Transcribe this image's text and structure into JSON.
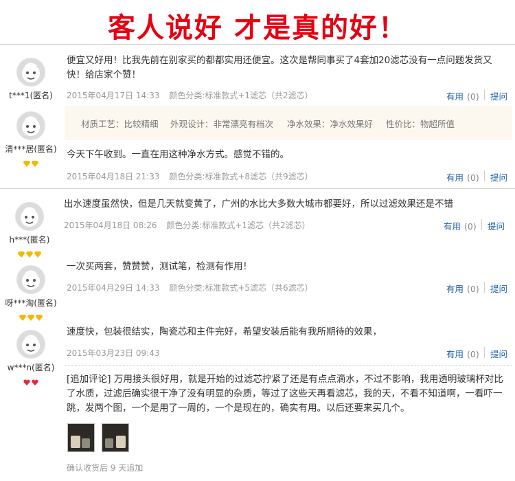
{
  "banner": {
    "title": "客人说好 才是真的好！",
    "color": "#e60012"
  },
  "actions": {
    "useful": "有用",
    "ask": "提问"
  },
  "tags": [
    "材质工艺：比较精细",
    "外观设计：非常漂亮有档次",
    "净水效果：净水效果好",
    "性价比：物超所值"
  ],
  "reviews": [
    {
      "user": "t***1(匿名)",
      "text": "便宜又好用！比我先前在别家买的都都实用还便宜。这次是帮同事买了4套加20滤芯没有一点问题发货又快！给店家个赞！",
      "date": "2015年04月17日 14:33",
      "sku": "颜色分类:标准款式+1滤芯（共2滤芯）",
      "useful_count": "(0)"
    },
    {
      "user": "清***居(匿名)",
      "text": "今天下午收到。一直在用这种净水方式。感觉不错的。",
      "date": "2015年04月18日 21:33",
      "sku": "颜色分类:标准款式+8滤芯（共9滤芯）",
      "useful_count": "(0)"
    },
    {
      "user": "h***(匿名)",
      "text": "出水速度虽然快，但是几天就变黄了，广州的水比大多数大城市都要好，所以过滤效果还是不错",
      "date": "2015年04月18日 08:26",
      "sku": "颜色分类:标准款式+1滤芯（共2滤芯）",
      "useful_count": "(0)"
    },
    {
      "user": "呀***淘(匿名)",
      "text": "一次买两套，赞赞赞，测试笔，检测有作用！",
      "date": "2015年04月29日 14:33",
      "sku": "颜色分类:标准款式+5滤芯（共6滤芯）",
      "useful_count": "(0)"
    },
    {
      "user": "w***n(匿名)",
      "text": "速度快，包装很结实，陶瓷芯和主件完好，希望安装后能有我所期待的效果，",
      "date": "2015年03月23日 09:43",
      "sku": "",
      "useful_count": "(0)",
      "followup": {
        "text": "[追加评论] 万用接头很好用，就是开始的过滤芯拧紧了还是有点点滴水，不过不影响，我用透明玻璃杯对比了水质，过滤后确实很干净了没有明显的杂质，等过了这些天再看滤芯，我的天，不看不知道啊，一看吓一跳，发两个图，一个是用了一周的，一个是现在的，确实有用。以后还要来买几个。",
        "after": "确认收货后 9 天追加"
      }
    }
  ]
}
